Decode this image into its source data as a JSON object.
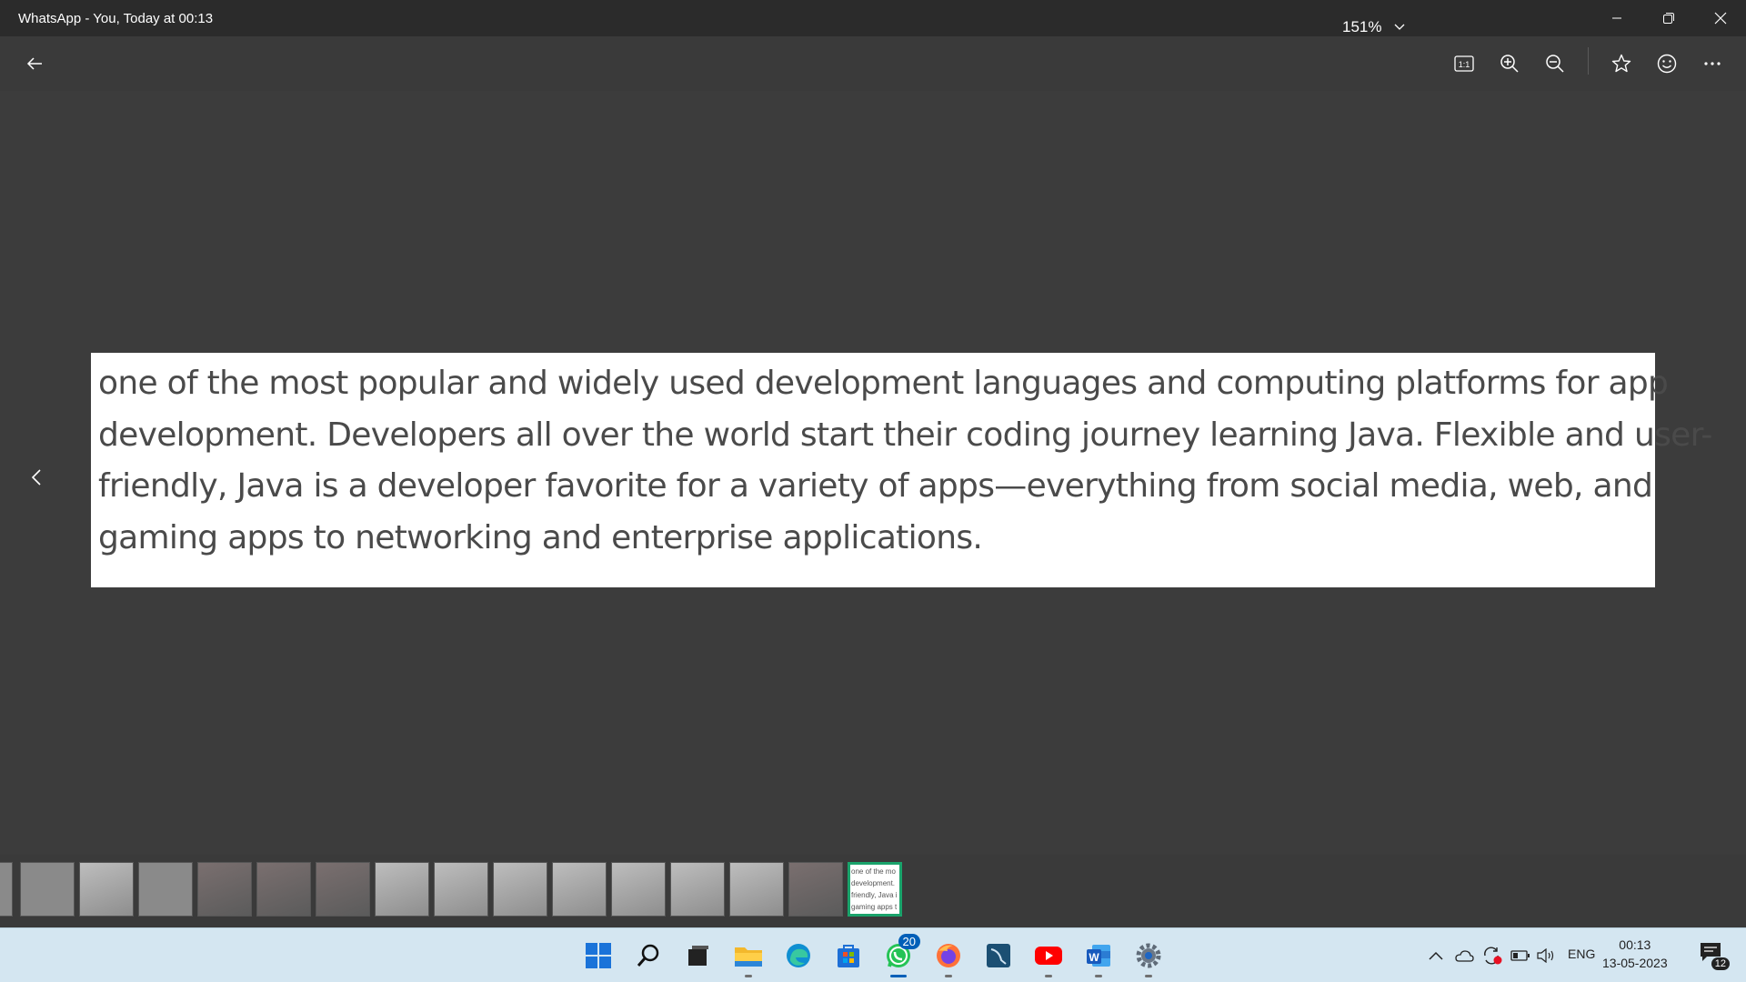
{
  "window": {
    "title": "WhatsApp - You, Today at 00:13"
  },
  "toolbar": {
    "zoom_level": "151%"
  },
  "image": {
    "lines": [
      "one of the most popular and widely used development languages and computing platforms for app",
      "development. Developers all over the world start their coding journey learning Java. Flexible and user-",
      "friendly, Java is a developer favorite for a variety of apps—everything from social media, web, and",
      "gaming apps to networking and enterprise applications."
    ]
  },
  "filmstrip": {
    "selected_thumb_lines": [
      "one of the mo",
      "development.",
      "friendly, Java i",
      "gaming apps t"
    ]
  },
  "taskbar": {
    "whatsapp_badge": "20",
    "language": "ENG",
    "time": "00:13",
    "date": "13-05-2023",
    "notification_count": "12"
  },
  "colors": {
    "accent": "#005fb8",
    "selected_border": "#1aa36b"
  }
}
